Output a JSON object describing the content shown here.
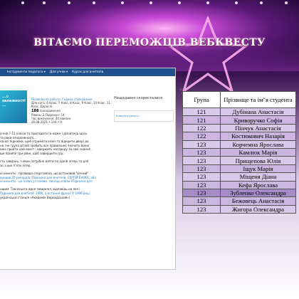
{
  "slide": {
    "title": "ВІТАЄМО ПЕРЕМОЖЦІВ ВЕБКВЕСТУ"
  },
  "browser": {
    "nav": {
      "logo": "",
      "items": [
        "Інструменти педагога ▾",
        "Для учнів ▾",
        "Курси для вчителів"
      ]
    },
    "thumb_text": "...о\nзалежності\n...",
    "meta": {
      "category": "Позакласна робота, Година спілкування",
      "grades": "Для кого: 6 Клас, 7 Клас, 8 Клас, 9 Клас, 10 Клас, 11 Клас, Дорослі",
      "count": "188",
      "count_label": "проходження",
      "rating": "Рівень: 2 Підрахун: 14",
      "updated": "Час виконання: 40 хвилин",
      "date": "26.08.2021 • 144 • 0"
    },
    "side": {
      "heading": "Нещодавно скористалися",
      "card": "Клацніть одного…"
    },
    "body_lines": [
      "учнів 7-11 класів та пригадати (а може і дізнатись щось",
      "та роки незалежності.",
      "на всі підказки, щоб отримати ключ та відкрити двері до",
      "на (чи група дітей) зробить все правильно, значить вона/",
      "оже пройти цей квест і одержить нагороду за свої знання .",
      "ще пройти три рівні, щоб завершити гру.",
      "",
      "сть завдань, з яких потрібно взяти по одній літері та для",
      "зо з цих п'яти літер.",
      "",
      "ої кімнати - прізвище спортсмена, що встановив \"вічний\"",
      "ановив 35 рекордів (Підказка для вчителя: СЕРГІЙ БУБКА, або",
      "ої кімнати - це назва установи, заклад освіти (Підказка для",
      "",
      "ншим. Там всього одне завдання, відповідь на яке і",
      "Підказка для вчителя: 1996, а остання фраза: У 1996 році",
      "українська станція «Академік Вернадський»)"
    ]
  },
  "table": {
    "headers": [
      "Група",
      "Прізвище та ім\"я студента"
    ],
    "rows": [
      {
        "group": "121",
        "name": "Дубінана Анастасія"
      },
      {
        "group": "121",
        "name": "Криворучко Софія"
      },
      {
        "group": "122",
        "name": "Пінчук Анастасія"
      },
      {
        "group": "122",
        "name": "Костюкович Назарія"
      },
      {
        "group": "123",
        "name": "Корчемна Ярослава"
      },
      {
        "group": "123",
        "name": "Камлюк Марія"
      },
      {
        "group": "123",
        "name": "Прищепова Юлія"
      },
      {
        "group": "123",
        "name": "Іщук Марія"
      },
      {
        "group": "123",
        "name": "Міщеня Діана"
      },
      {
        "group": "123",
        "name": "Кефа Ярослава"
      },
      {
        "group": "123",
        "name": "Зубленко Олександра"
      },
      {
        "group": "123",
        "name": "Бежовець Анастасія"
      },
      {
        "group": "123",
        "name": "Жигора Олександра"
      }
    ]
  }
}
